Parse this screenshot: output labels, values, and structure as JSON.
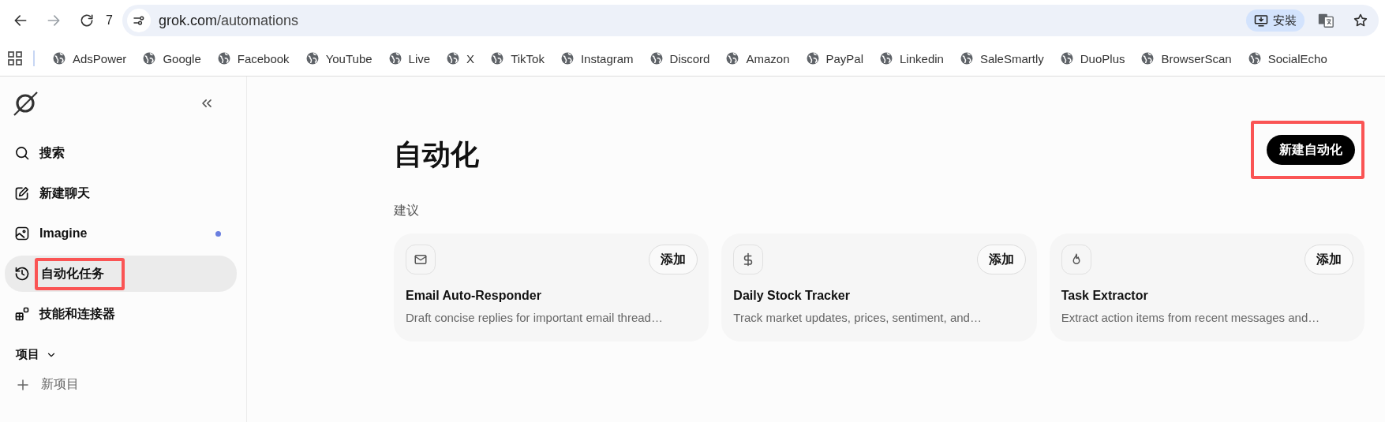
{
  "browser": {
    "back_disabled": false,
    "forward_disabled": true,
    "tab_count": "7",
    "url_host": "grok.com",
    "url_path": "/automations",
    "install_label": "安裝"
  },
  "bookmarks": [
    {
      "label": "AdsPower"
    },
    {
      "label": "Google"
    },
    {
      "label": "Facebook"
    },
    {
      "label": "YouTube"
    },
    {
      "label": "Live"
    },
    {
      "label": "X"
    },
    {
      "label": "TikTok"
    },
    {
      "label": "Instagram"
    },
    {
      "label": "Discord"
    },
    {
      "label": "Amazon"
    },
    {
      "label": "PayPal"
    },
    {
      "label": "Linkedin"
    },
    {
      "label": "SaleSmartly"
    },
    {
      "label": "DuoPlus"
    },
    {
      "label": "BrowserScan"
    },
    {
      "label": "SocialEcho"
    }
  ],
  "sidebar": {
    "items": [
      {
        "label": "搜索",
        "selected": false,
        "highlighted": false,
        "new_dot": false
      },
      {
        "label": "新建聊天",
        "selected": false,
        "highlighted": false,
        "new_dot": false
      },
      {
        "label": "Imagine",
        "selected": false,
        "highlighted": false,
        "new_dot": true
      },
      {
        "label": "自动化任务",
        "selected": true,
        "highlighted": true,
        "new_dot": false
      },
      {
        "label": "技能和连接器",
        "selected": false,
        "highlighted": false,
        "new_dot": false
      }
    ],
    "projects": {
      "label": "项目",
      "expanded": true,
      "new_label": "新项目"
    }
  },
  "main": {
    "title": "自动化",
    "new_button": {
      "label": "新建自动化",
      "highlighted": true
    },
    "section": "建议",
    "cards": [
      {
        "title": "Email Auto-Responder",
        "description": "Draft concise replies for important email thread…",
        "button": "添加"
      },
      {
        "title": "Daily Stock Tracker",
        "description": "Track market updates, prices, sentiment, and…",
        "button": "添加"
      },
      {
        "title": "Task Extractor",
        "description": "Extract action items from recent messages and…",
        "button": "添加"
      }
    ]
  }
}
